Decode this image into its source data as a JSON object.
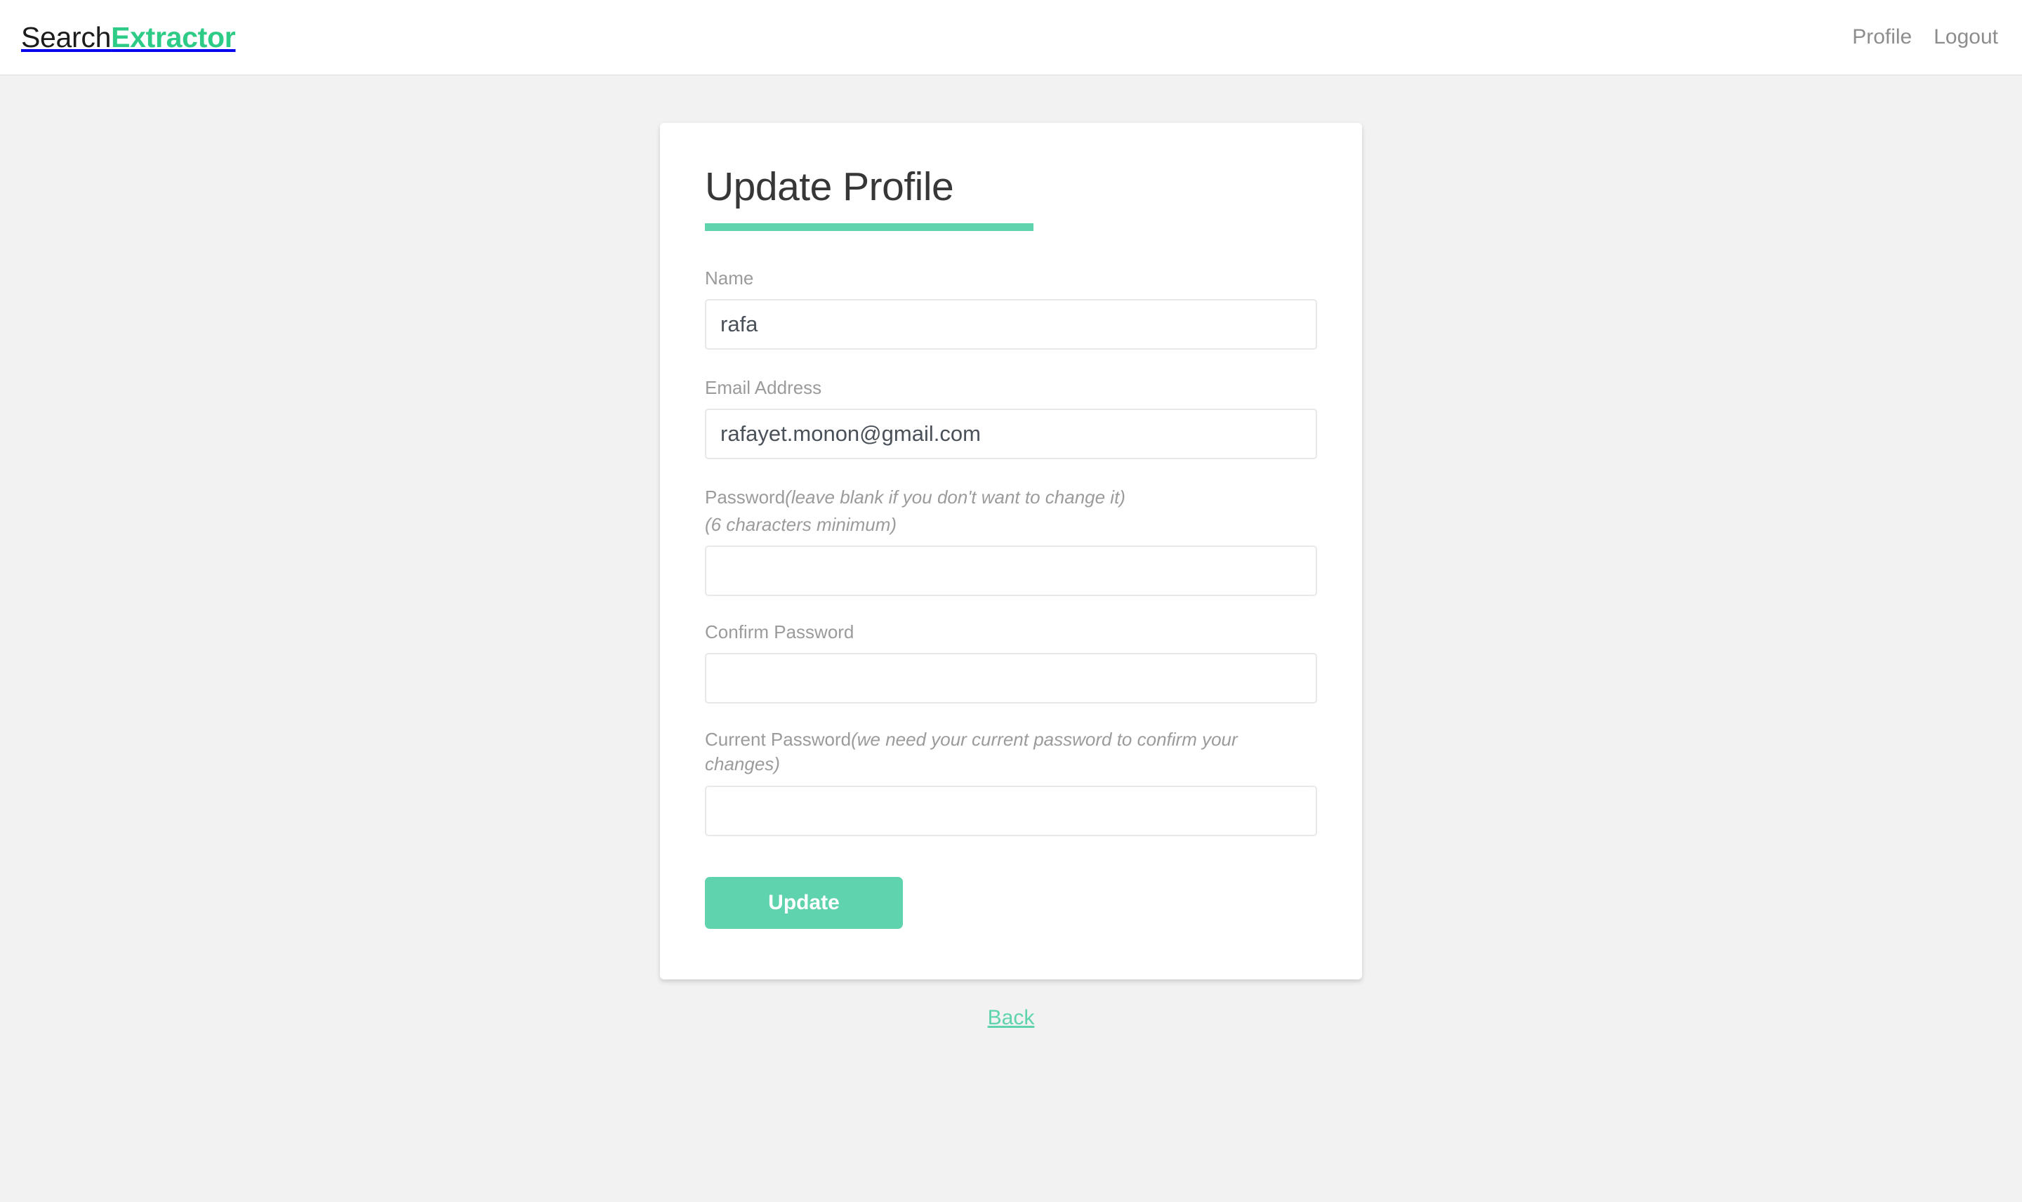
{
  "navbar": {
    "brand": {
      "primary_text": "Search",
      "accent_text": "Extractor",
      "accent_color": "#2ecb87"
    },
    "links": [
      {
        "label": "Profile"
      },
      {
        "label": "Logout"
      }
    ]
  },
  "card": {
    "title": "Update Profile",
    "accent_color": "#5fd3ae",
    "fields": [
      {
        "id": "name",
        "label": "Name",
        "hint": "",
        "hint_line": "",
        "value": "rafa",
        "placeholder": "",
        "type": "text"
      },
      {
        "id": "email",
        "label": "Email Address",
        "hint": "",
        "hint_line": "",
        "value": "rafayet.monon@gmail.com",
        "placeholder": "",
        "type": "email"
      },
      {
        "id": "password",
        "label": "Password",
        "hint": "(leave blank if you don't want to change it)",
        "hint_line": "(6 characters minimum)",
        "value": "",
        "placeholder": "",
        "type": "password"
      },
      {
        "id": "confirm-password",
        "label": "Confirm Password",
        "hint": "",
        "hint_line": "",
        "value": "",
        "placeholder": "",
        "type": "password"
      },
      {
        "id": "current-password",
        "label": "Current Password",
        "hint": "(we need your current password to confirm your changes)",
        "hint_line": "",
        "value": "",
        "placeholder": "",
        "type": "password"
      }
    ],
    "submit_label": "Update"
  },
  "footer": {
    "back_label": "Back"
  }
}
